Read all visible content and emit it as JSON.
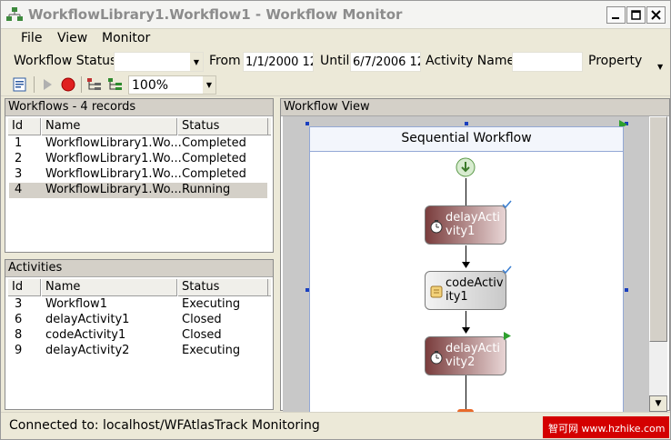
{
  "window": {
    "title": "WorkflowLibrary1.Workflow1 - Workflow Monitor"
  },
  "menu": [
    "File",
    "View",
    "Monitor"
  ],
  "filter": {
    "status_label": "Workflow Status",
    "status_value": "",
    "from_label": "From",
    "from_value": "1/1/2000 12:",
    "until_label": "Until",
    "until_value": "6/7/2006 12:",
    "activity_name_label": "Activity Name",
    "activity_name_value": "",
    "property_label": "Property"
  },
  "toolbar": {
    "zoom": "100%"
  },
  "workflows": {
    "header": "Workflows - 4 records",
    "columns": [
      "Id",
      "Name",
      "Status"
    ],
    "rows": [
      {
        "id": "1",
        "name": "WorkflowLibrary1.Wo...",
        "status": "Completed"
      },
      {
        "id": "2",
        "name": "WorkflowLibrary1.Wo...",
        "status": "Completed"
      },
      {
        "id": "3",
        "name": "WorkflowLibrary1.Wo...",
        "status": "Completed"
      },
      {
        "id": "4",
        "name": "WorkflowLibrary1.Wo...",
        "status": "Running"
      }
    ]
  },
  "activities": {
    "header": "Activities",
    "columns": [
      "Id",
      "Name",
      "Status"
    ],
    "rows": [
      {
        "id": "3",
        "name": "Workflow1",
        "status": "Executing"
      },
      {
        "id": "6",
        "name": "delayActivity1",
        "status": "Closed"
      },
      {
        "id": "8",
        "name": "codeActivity1",
        "status": "Closed"
      },
      {
        "id": "9",
        "name": "delayActivity2",
        "status": "Executing"
      }
    ]
  },
  "workflow_view": {
    "header": "Workflow View",
    "sequence_title": "Sequential Workflow",
    "activities": [
      {
        "label": "delayActivity1",
        "kind": "delay"
      },
      {
        "label": "codeActivity1",
        "kind": "code"
      },
      {
        "label": "delayActivity2",
        "kind": "delay"
      }
    ]
  },
  "status": {
    "text": "Connected to: localhost/WFAtlasTrack Monitoring"
  },
  "watermark": "智可网 www.hzhike.com",
  "colors": {
    "delay_dark": "#7a3d3d",
    "selection": "#d4d0c8",
    "check_blue": "#3c7fd1",
    "running_green": "#2ea02e"
  }
}
